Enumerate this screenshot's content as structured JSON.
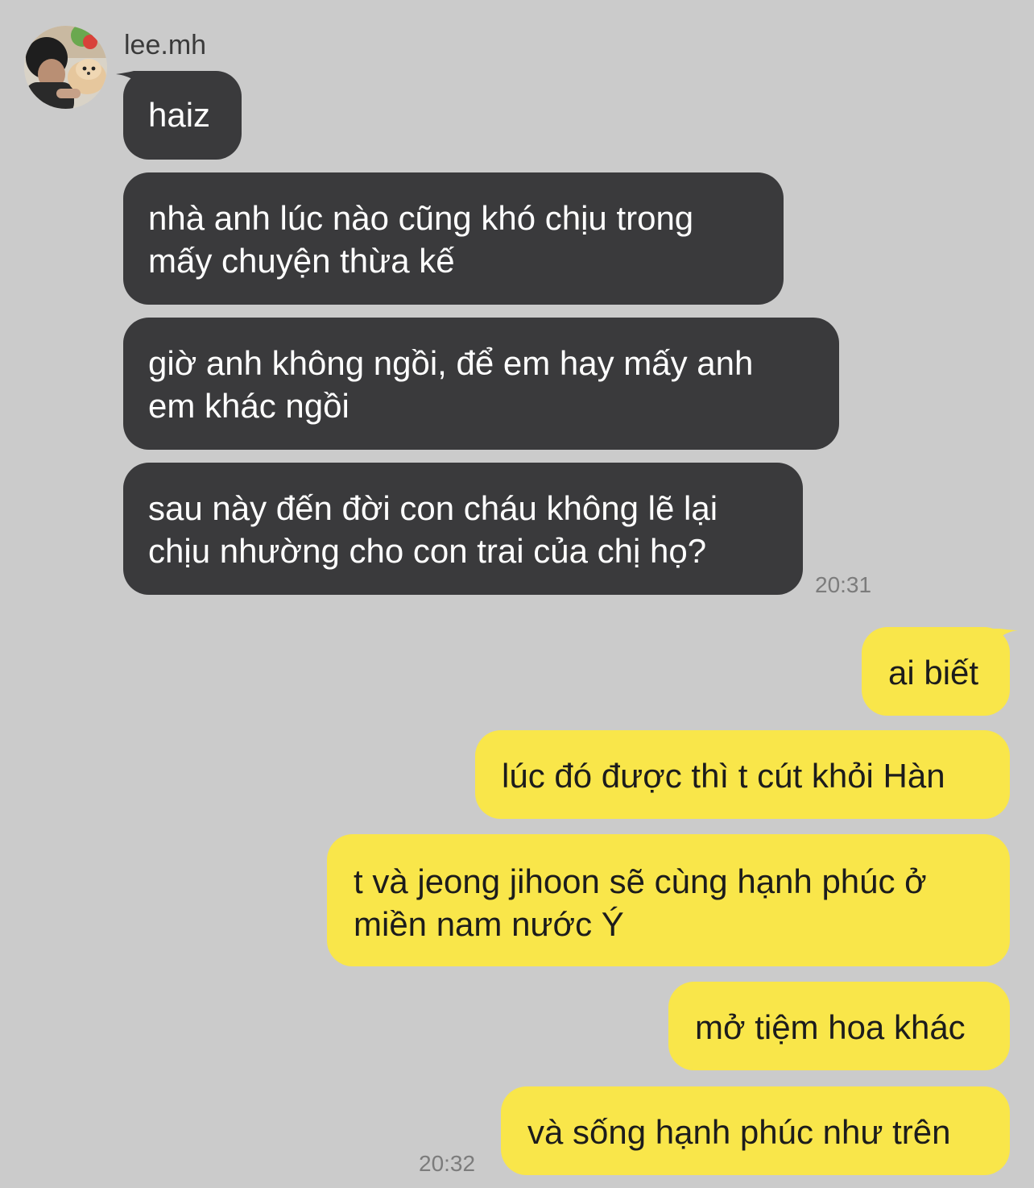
{
  "chat": {
    "sender_name": "lee.mh",
    "avatar_icon": "user-photo-avatar",
    "colors": {
      "background": "#cbcbcb",
      "incoming_bubble": "#3a3a3c",
      "incoming_text": "#ffffff",
      "outgoing_bubble": "#f9e64a",
      "outgoing_text": "#1c1c1c",
      "timestamp": "#7c7c7c"
    },
    "incoming": [
      {
        "lines": [
          "haiz"
        ]
      },
      {
        "lines": [
          "nhà anh lúc nào cũng khó chịu trong",
          "mấy chuyện thừa kế"
        ]
      },
      {
        "lines": [
          "giờ anh không ngồi, để em hay mấy anh",
          "em khác ngồi"
        ]
      },
      {
        "lines": [
          "sau này đến đời con cháu không lẽ lại",
          "chịu nhường cho con trai của chị họ?"
        ]
      }
    ],
    "incoming_time": "20:31",
    "outgoing": [
      {
        "lines": [
          "ai biết"
        ]
      },
      {
        "lines": [
          "lúc đó được thì t cút khỏi Hàn"
        ]
      },
      {
        "lines": [
          "t và jeong jihoon sẽ cùng hạnh phúc ở",
          "miền nam nước Ý"
        ]
      },
      {
        "lines": [
          "mở tiệm hoa khác"
        ]
      },
      {
        "lines": [
          "và sống hạnh phúc như trên"
        ]
      }
    ],
    "outgoing_time": "20:32"
  }
}
